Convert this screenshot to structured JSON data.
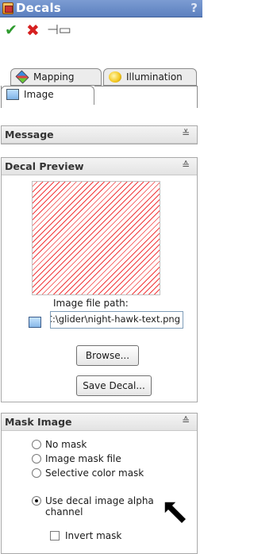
{
  "window": {
    "title": "Decals",
    "help_label": "?"
  },
  "commands": {
    "ok_icon": "check-icon",
    "cancel_icon": "x-icon",
    "pin_icon": "pushpin-icon"
  },
  "tabs": [
    {
      "label": "Mapping",
      "icon": "mapping-icon"
    },
    {
      "label": "Illumination",
      "icon": "illumination-icon"
    },
    {
      "label": "Image",
      "icon": "image-icon"
    }
  ],
  "message": {
    "title": "Message",
    "state": "collapsed"
  },
  "decal_preview": {
    "title": "Decal Preview",
    "state": "expanded",
    "image_path_label": "Image file path:",
    "image_path_value": "C:\\glider\\night-hawk-text.png",
    "browse_label": "Browse...",
    "save_label": "Save Decal..."
  },
  "mask_image": {
    "title": "Mask Image",
    "state": "expanded",
    "options": [
      {
        "label": "No mask",
        "selected": false
      },
      {
        "label": "Image mask file",
        "selected": false
      },
      {
        "label": "Selective color mask",
        "selected": false
      },
      {
        "label_line1": "Use decal image alpha",
        "label_line2": "channel",
        "selected": true
      }
    ],
    "invert_mask": {
      "label": "Invert mask",
      "checked": false
    }
  },
  "colors": {
    "title_bar": "#5b7fbf",
    "ok": "#2f9b2f",
    "cancel": "#d62020",
    "preview_hatch": "#f2383a"
  }
}
